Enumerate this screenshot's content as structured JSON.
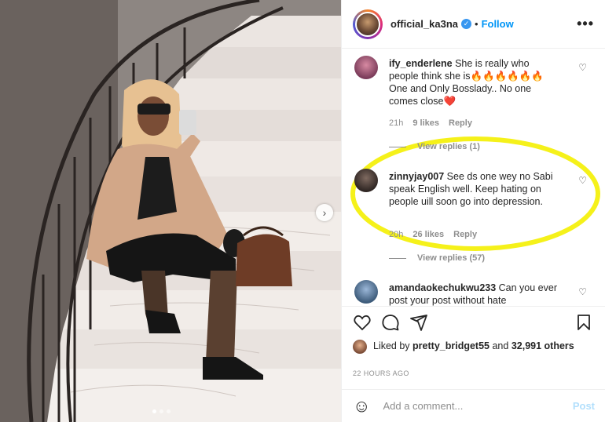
{
  "post": {
    "username": "official_ka3na",
    "separator": "•",
    "follow_label": "Follow",
    "more_label": "•••",
    "carousel_next": "›"
  },
  "comments": [
    {
      "username": "ify_enderlene",
      "text": "She is really who people think she is🔥🔥🔥🔥🔥🔥 One and Only Bosslady.. No one comes close❤️",
      "time": "21h",
      "likes": "9 likes",
      "reply_label": "Reply",
      "view_replies": "View replies (1)"
    },
    {
      "username": "zinnyjay007",
      "text": "See ds one wey no Sabi speak English well. Keep hating on people uill soon go into depression.",
      "time": "20h",
      "likes": "26 likes",
      "reply_label": "Reply",
      "view_replies": "View replies (57)",
      "highlight_color": "#f5f11a"
    },
    {
      "username": "amandaokechukwu233",
      "text": "Can you ever post your post without hate"
    }
  ],
  "likes_section": {
    "liked_by_prefix": "Liked by",
    "liked_by_user": "pretty_bridget55",
    "and_word": "and",
    "others_count": "32,991 others"
  },
  "timestamp": "22 HOURS AGO",
  "add_comment": {
    "placeholder": "Add a comment...",
    "post_label": "Post"
  },
  "icons": [
    "verified-icon",
    "heart-icon",
    "comment-icon",
    "share-icon",
    "bookmark-icon",
    "smile-icon",
    "more-icon"
  ],
  "colors": {
    "accent": "#0095f6",
    "verified": "#3897f0",
    "highlight": "#f5f11a",
    "post_disabled": "#b2dffc"
  }
}
